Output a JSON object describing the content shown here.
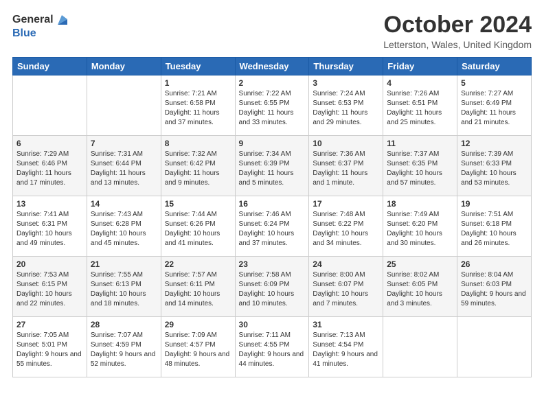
{
  "header": {
    "logo_general": "General",
    "logo_blue": "Blue",
    "month_title": "October 2024",
    "location": "Letterston, Wales, United Kingdom"
  },
  "days_of_week": [
    "Sunday",
    "Monday",
    "Tuesday",
    "Wednesday",
    "Thursday",
    "Friday",
    "Saturday"
  ],
  "weeks": [
    [
      {
        "day": "",
        "content": ""
      },
      {
        "day": "",
        "content": ""
      },
      {
        "day": "1",
        "content": "Sunrise: 7:21 AM\nSunset: 6:58 PM\nDaylight: 11 hours and 37 minutes."
      },
      {
        "day": "2",
        "content": "Sunrise: 7:22 AM\nSunset: 6:55 PM\nDaylight: 11 hours and 33 minutes."
      },
      {
        "day": "3",
        "content": "Sunrise: 7:24 AM\nSunset: 6:53 PM\nDaylight: 11 hours and 29 minutes."
      },
      {
        "day": "4",
        "content": "Sunrise: 7:26 AM\nSunset: 6:51 PM\nDaylight: 11 hours and 25 minutes."
      },
      {
        "day": "5",
        "content": "Sunrise: 7:27 AM\nSunset: 6:49 PM\nDaylight: 11 hours and 21 minutes."
      }
    ],
    [
      {
        "day": "6",
        "content": "Sunrise: 7:29 AM\nSunset: 6:46 PM\nDaylight: 11 hours and 17 minutes."
      },
      {
        "day": "7",
        "content": "Sunrise: 7:31 AM\nSunset: 6:44 PM\nDaylight: 11 hours and 13 minutes."
      },
      {
        "day": "8",
        "content": "Sunrise: 7:32 AM\nSunset: 6:42 PM\nDaylight: 11 hours and 9 minutes."
      },
      {
        "day": "9",
        "content": "Sunrise: 7:34 AM\nSunset: 6:39 PM\nDaylight: 11 hours and 5 minutes."
      },
      {
        "day": "10",
        "content": "Sunrise: 7:36 AM\nSunset: 6:37 PM\nDaylight: 11 hours and 1 minute."
      },
      {
        "day": "11",
        "content": "Sunrise: 7:37 AM\nSunset: 6:35 PM\nDaylight: 10 hours and 57 minutes."
      },
      {
        "day": "12",
        "content": "Sunrise: 7:39 AM\nSunset: 6:33 PM\nDaylight: 10 hours and 53 minutes."
      }
    ],
    [
      {
        "day": "13",
        "content": "Sunrise: 7:41 AM\nSunset: 6:31 PM\nDaylight: 10 hours and 49 minutes."
      },
      {
        "day": "14",
        "content": "Sunrise: 7:43 AM\nSunset: 6:28 PM\nDaylight: 10 hours and 45 minutes."
      },
      {
        "day": "15",
        "content": "Sunrise: 7:44 AM\nSunset: 6:26 PM\nDaylight: 10 hours and 41 minutes."
      },
      {
        "day": "16",
        "content": "Sunrise: 7:46 AM\nSunset: 6:24 PM\nDaylight: 10 hours and 37 minutes."
      },
      {
        "day": "17",
        "content": "Sunrise: 7:48 AM\nSunset: 6:22 PM\nDaylight: 10 hours and 34 minutes."
      },
      {
        "day": "18",
        "content": "Sunrise: 7:49 AM\nSunset: 6:20 PM\nDaylight: 10 hours and 30 minutes."
      },
      {
        "day": "19",
        "content": "Sunrise: 7:51 AM\nSunset: 6:18 PM\nDaylight: 10 hours and 26 minutes."
      }
    ],
    [
      {
        "day": "20",
        "content": "Sunrise: 7:53 AM\nSunset: 6:15 PM\nDaylight: 10 hours and 22 minutes."
      },
      {
        "day": "21",
        "content": "Sunrise: 7:55 AM\nSunset: 6:13 PM\nDaylight: 10 hours and 18 minutes."
      },
      {
        "day": "22",
        "content": "Sunrise: 7:57 AM\nSunset: 6:11 PM\nDaylight: 10 hours and 14 minutes."
      },
      {
        "day": "23",
        "content": "Sunrise: 7:58 AM\nSunset: 6:09 PM\nDaylight: 10 hours and 10 minutes."
      },
      {
        "day": "24",
        "content": "Sunrise: 8:00 AM\nSunset: 6:07 PM\nDaylight: 10 hours and 7 minutes."
      },
      {
        "day": "25",
        "content": "Sunrise: 8:02 AM\nSunset: 6:05 PM\nDaylight: 10 hours and 3 minutes."
      },
      {
        "day": "26",
        "content": "Sunrise: 8:04 AM\nSunset: 6:03 PM\nDaylight: 9 hours and 59 minutes."
      }
    ],
    [
      {
        "day": "27",
        "content": "Sunrise: 7:05 AM\nSunset: 5:01 PM\nDaylight: 9 hours and 55 minutes."
      },
      {
        "day": "28",
        "content": "Sunrise: 7:07 AM\nSunset: 4:59 PM\nDaylight: 9 hours and 52 minutes."
      },
      {
        "day": "29",
        "content": "Sunrise: 7:09 AM\nSunset: 4:57 PM\nDaylight: 9 hours and 48 minutes."
      },
      {
        "day": "30",
        "content": "Sunrise: 7:11 AM\nSunset: 4:55 PM\nDaylight: 9 hours and 44 minutes."
      },
      {
        "day": "31",
        "content": "Sunrise: 7:13 AM\nSunset: 4:54 PM\nDaylight: 9 hours and 41 minutes."
      },
      {
        "day": "",
        "content": ""
      },
      {
        "day": "",
        "content": ""
      }
    ]
  ]
}
